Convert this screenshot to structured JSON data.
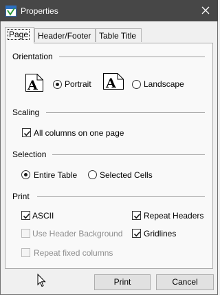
{
  "window": {
    "title": "Properties"
  },
  "tabs": [
    {
      "label": "Page",
      "active": true
    },
    {
      "label": "Header/Footer",
      "active": false
    },
    {
      "label": "Table Title",
      "active": false
    }
  ],
  "orientation": {
    "label": "Orientation",
    "page_icon_glyph": "A",
    "portrait": {
      "label": "Portrait",
      "selected": true
    },
    "landscape": {
      "label": "Landscape",
      "selected": false
    }
  },
  "scaling": {
    "label": "Scaling",
    "all_columns": {
      "label": "All columns on one page",
      "checked": true
    }
  },
  "selection": {
    "label": "Selection",
    "entire_table": {
      "label": "Entire Table",
      "selected": true
    },
    "selected_cells": {
      "label": "Selected Cells",
      "selected": false
    }
  },
  "print": {
    "label": "Print",
    "ascii": {
      "label": "ASCII",
      "checked": true,
      "enabled": true
    },
    "use_header_background": {
      "label": "Use Header Background",
      "checked": false,
      "enabled": false
    },
    "repeat_fixed_columns": {
      "label": "Repeat fixed columns",
      "checked": false,
      "enabled": false
    },
    "repeat_headers": {
      "label": "Repeat Headers",
      "checked": true,
      "enabled": true
    },
    "gridlines": {
      "label": "Gridlines",
      "checked": true,
      "enabled": true
    }
  },
  "buttons": {
    "print": "Print",
    "cancel": "Cancel"
  },
  "colors": {
    "titlebar": "#474747",
    "dialog_bg": "#f0f0f0",
    "panel_bg": "#f9f9f9",
    "disabled_text": "#8d8d8d"
  }
}
